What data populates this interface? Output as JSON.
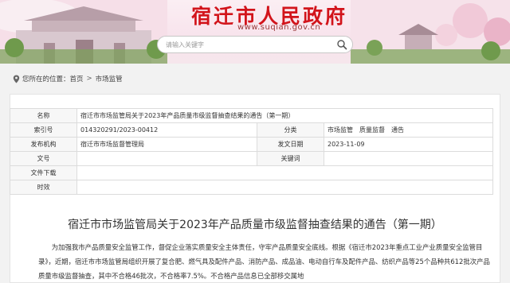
{
  "header": {
    "site_title": "宿迁市人民政府",
    "site_domain": "www.suqian.gov.cn",
    "search": {
      "placeholder": "请输入关键字",
      "value": ""
    }
  },
  "breadcrumb": {
    "prefix": "您所在的位置：",
    "items": [
      "首页",
      "市场监管"
    ],
    "separator": ">"
  },
  "meta_table": {
    "rows": [
      {
        "k1": "名称",
        "v1": "宿迁市市场监管局关于2023年产品质量市级监督抽查结果的通告（第一期）",
        "k2": "",
        "v2": ""
      },
      {
        "k1": "索引号",
        "v1": "014320291/2023-00412",
        "k2": "分类",
        "v2": "市场监管　质量监督　通告"
      },
      {
        "k1": "发布机构",
        "v1": "宿迁市市场监督管理局",
        "k2": "发文日期",
        "v2": "2023-11-09"
      },
      {
        "k1": "文号",
        "v1": "",
        "k2": "关键词",
        "v2": ""
      },
      {
        "k1": "文件下载",
        "v1": "",
        "k2": "",
        "v2": ""
      },
      {
        "k1": "时效",
        "v1": "",
        "k2": "",
        "v2": ""
      }
    ]
  },
  "document": {
    "title": "宿迁市市场监管局关于2023年产品质量市级监督抽查结果的通告（第一期）",
    "paragraph": "为加强我市产品质量安全监管工作，督促企业落实质量安全主体责任，守牢产品质量安全底线。根据《宿迁市2023年重点工业产业质量安全监管目录》，近期，宿迁市市场监管局组织开展了复合肥、燃气具及配件产品、消防产品、成品油、电动自行车及配件产品、纺织产品等25个品种共612批次产品质量市级监督抽查，其中不合格46批次，不合格率7.5%。不合格产品信息已全部移交属地"
  },
  "colors": {
    "title_red": "#d2141b",
    "header_bg": "#f8e3ec",
    "page_bg": "#f2f2f2"
  },
  "icons": {
    "search": "search-icon",
    "location": "location-pin-icon",
    "header_left": "city-gate-illustration",
    "header_right": "garden-pavilion-illustration"
  }
}
